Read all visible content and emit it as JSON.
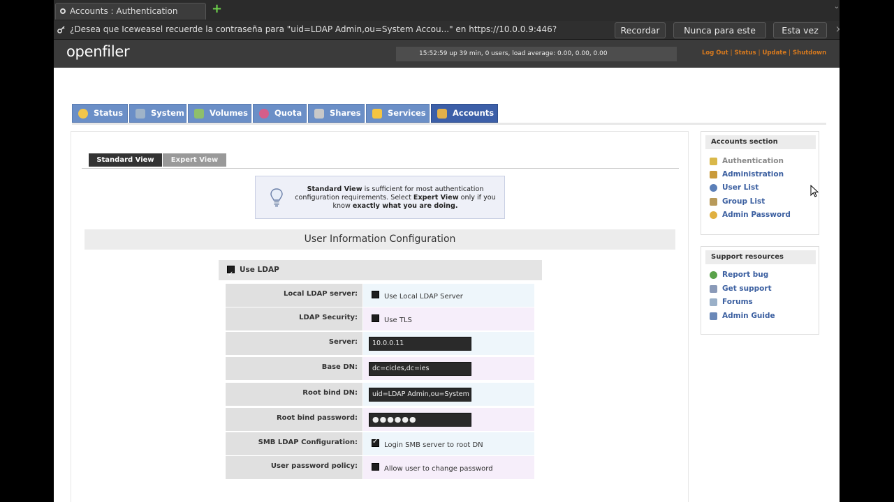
{
  "browser": {
    "tab_title": "Accounts : Authentication",
    "new_tab_symbol": "+",
    "notification_text": "¿Desea que Iceweasel recuerde la contraseña para \"uid=LDAP Admin,ou=System Accou...\" en https://10.0.0.9:446?",
    "buttons": {
      "remember": "Recordar",
      "never": "Nunca para este sitio",
      "not_now": "Esta vez no"
    },
    "close_symbol": "×"
  },
  "header": {
    "logo": "openfiler",
    "status_text": "15:52:59 up 39 min, 0 users, load average: 0.00, 0.00, 0.00",
    "links": [
      "Log Out",
      "Status",
      "Update",
      "Shutdown"
    ],
    "link_color": "#d87a1e"
  },
  "nav": {
    "tabs": [
      {
        "label": "Status",
        "icon": "sun-icon",
        "color": "#f3c64a"
      },
      {
        "label": "System",
        "icon": "monitor-icon",
        "color": "#9fb3c8"
      },
      {
        "label": "Volumes",
        "icon": "disk-icon",
        "color": "#8fbf6a"
      },
      {
        "label": "Quota",
        "icon": "pie-icon",
        "color": "#d55e8a"
      },
      {
        "label": "Shares",
        "icon": "drive-icon",
        "color": "#c8c8c8"
      },
      {
        "label": "Services",
        "icon": "lightning-icon",
        "color": "#f5c542"
      },
      {
        "label": "Accounts",
        "icon": "users-icon",
        "color": "#e2b04a"
      }
    ],
    "active": "Accounts",
    "active_color": "#3c5fa8",
    "tab_color": "#6b8fc7"
  },
  "views": {
    "standard": "Standard View",
    "expert": "Expert View"
  },
  "info": {
    "bold1": "Standard View",
    "text1": " is sufficient for most authentication configuration requirements. Select ",
    "bold2": "Expert View",
    "text2": " only if you know ",
    "bold3": "exactly what you are doing."
  },
  "section_title": "User Information Configuration",
  "ldap": {
    "use_ldap_label": "Use LDAP",
    "use_ldap_checked": true,
    "rows": [
      {
        "label": "Local LDAP server:",
        "type": "checkbox",
        "text": "Use Local LDAP Server",
        "checked": false
      },
      {
        "label": "LDAP Security:",
        "type": "checkbox",
        "text": "Use TLS",
        "checked": false
      },
      {
        "label": "Server:",
        "type": "input",
        "value": "10.0.0.11"
      },
      {
        "label": "Base DN:",
        "type": "input",
        "value": "dc=cicles,dc=ies"
      },
      {
        "label": "Root bind DN:",
        "type": "input",
        "value": "uid=LDAP Admin,ou=System"
      },
      {
        "label": "Root bind password:",
        "type": "password",
        "value": "●●●●●●"
      },
      {
        "label": "SMB LDAP Configuration:",
        "type": "checkbox",
        "text": "Login SMB server to root DN",
        "checked": true
      },
      {
        "label": "User password policy:",
        "type": "checkbox",
        "text": "Allow user to change password",
        "checked": false
      }
    ]
  },
  "sidebar": {
    "accounts": {
      "title": "Accounts section",
      "items": [
        {
          "label": "Authentication",
          "icon": "lock-icon",
          "current": true
        },
        {
          "label": "Administration",
          "icon": "admin-icon",
          "current": false
        },
        {
          "label": "User List",
          "icon": "user-icon",
          "current": false
        },
        {
          "label": "Group List",
          "icon": "group-icon",
          "current": false
        },
        {
          "label": "Admin Password",
          "icon": "key-icon",
          "current": false
        }
      ]
    },
    "support": {
      "title": "Support resources",
      "items": [
        {
          "label": "Report bug",
          "icon": "bug-icon"
        },
        {
          "label": "Get support",
          "icon": "support-icon"
        },
        {
          "label": "Forums",
          "icon": "forum-icon"
        },
        {
          "label": "Admin Guide",
          "icon": "book-icon"
        }
      ]
    },
    "link_color": "#3b5fa0"
  }
}
